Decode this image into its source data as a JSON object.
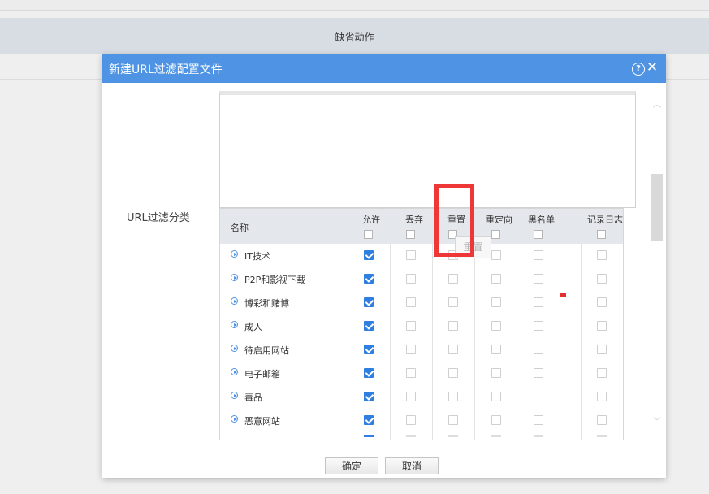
{
  "background": {
    "header_title": "缺省动作"
  },
  "dialog": {
    "title": "新建URL过滤配置文件",
    "help_icon": "?",
    "close_icon": "✕",
    "category_label": "URL过滤分类",
    "tooltip": "重置",
    "columns": [
      {
        "key": "name",
        "label": "名称"
      },
      {
        "key": "allow",
        "label": "允许"
      },
      {
        "key": "discard",
        "label": "丢弃"
      },
      {
        "key": "reset",
        "label": "重置"
      },
      {
        "key": "redirect",
        "label": "重定向"
      },
      {
        "key": "blacklist",
        "label": "黑名单"
      },
      {
        "key": "log",
        "label": "记录日志"
      }
    ],
    "rows": [
      {
        "name": "IT技术",
        "allow": true,
        "discard": false,
        "reset": false,
        "redirect": false,
        "blacklist": false,
        "log": false
      },
      {
        "name": "P2P和影视下载",
        "allow": true,
        "discard": false,
        "reset": false,
        "redirect": false,
        "blacklist": false,
        "log": false
      },
      {
        "name": "博彩和赌博",
        "allow": true,
        "discard": false,
        "reset": false,
        "redirect": false,
        "blacklist": false,
        "log": false
      },
      {
        "name": "成人",
        "allow": true,
        "discard": false,
        "reset": false,
        "redirect": false,
        "blacklist": false,
        "log": false
      },
      {
        "name": "待启用网站",
        "allow": true,
        "discard": false,
        "reset": false,
        "redirect": false,
        "blacklist": false,
        "log": false
      },
      {
        "name": "电子邮箱",
        "allow": true,
        "discard": false,
        "reset": false,
        "redirect": false,
        "blacklist": false,
        "log": false
      },
      {
        "name": "毒品",
        "allow": true,
        "discard": false,
        "reset": false,
        "redirect": false,
        "blacklist": false,
        "log": false
      },
      {
        "name": "恶意网站",
        "allow": true,
        "discard": false,
        "reset": false,
        "redirect": false,
        "blacklist": false,
        "log": false
      }
    ],
    "buttons": {
      "ok": "确定",
      "cancel": "取消"
    }
  },
  "colors": {
    "title_bar": "#4f94e4",
    "checkbox_checked": "#2f7fe0",
    "highlight": "#ee3838"
  }
}
